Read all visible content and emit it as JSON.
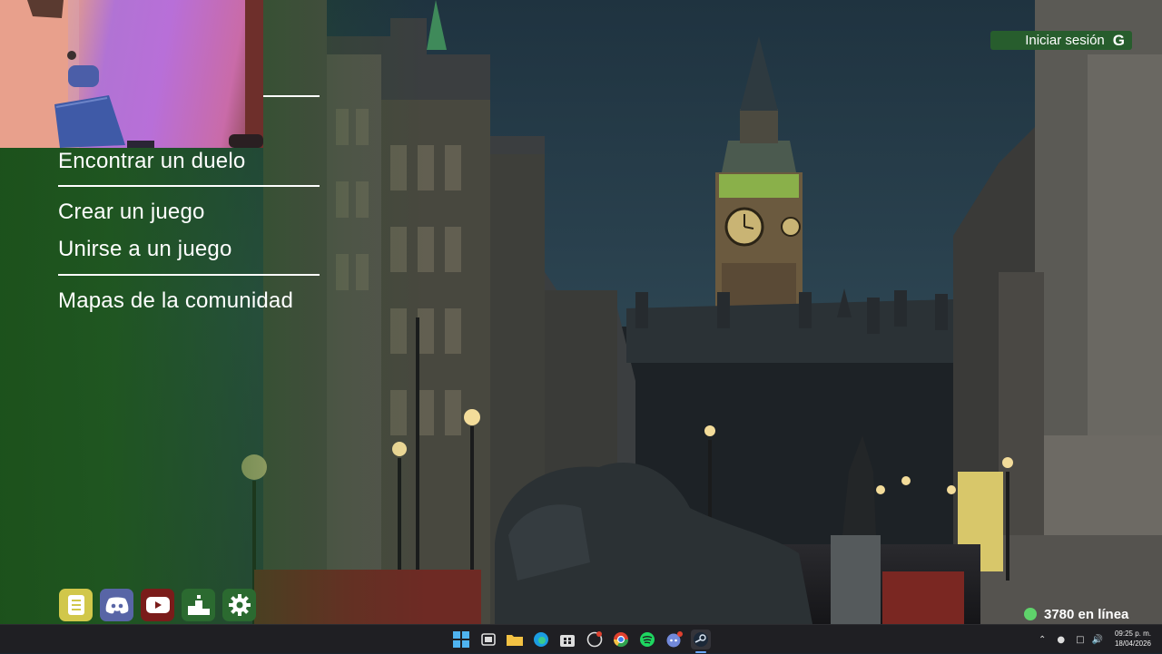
{
  "menu": {
    "items": [
      {
        "label": "Encontrar un duelo"
      },
      {
        "label": "Crear un juego"
      },
      {
        "label": "Unirse a un juego"
      },
      {
        "label": "Mapas de la comunidad"
      }
    ]
  },
  "signin": {
    "label": "Iniciar sesión",
    "provider_icon": "G"
  },
  "bottom_buttons": [
    {
      "name": "notebook-button",
      "icon": "notebook-icon",
      "color": "#d1c74a"
    },
    {
      "name": "discord-button",
      "icon": "discord-icon",
      "color": "#5865a6"
    },
    {
      "name": "youtube-button",
      "icon": "youtube-icon",
      "color": "#7a1c1a"
    },
    {
      "name": "leaderboard-button",
      "icon": "podium-icon",
      "color": "#2b6a30"
    },
    {
      "name": "settings-button",
      "icon": "gear-icon",
      "color": "#2b6a30"
    }
  ],
  "online": {
    "count_label": "3780 en línea",
    "status_color": "#5fd36b"
  },
  "taskbar": {
    "apps": [
      "windows-start",
      "task-view",
      "file-explorer",
      "edge",
      "store",
      "github-desktop",
      "chrome",
      "spotify",
      "discord",
      "steam"
    ],
    "clock_time": "09:25 p. m.",
    "clock_date": "18/04/2026"
  },
  "colors": {
    "accent_green": "#275d2d",
    "panel_green": "#1c521a"
  }
}
